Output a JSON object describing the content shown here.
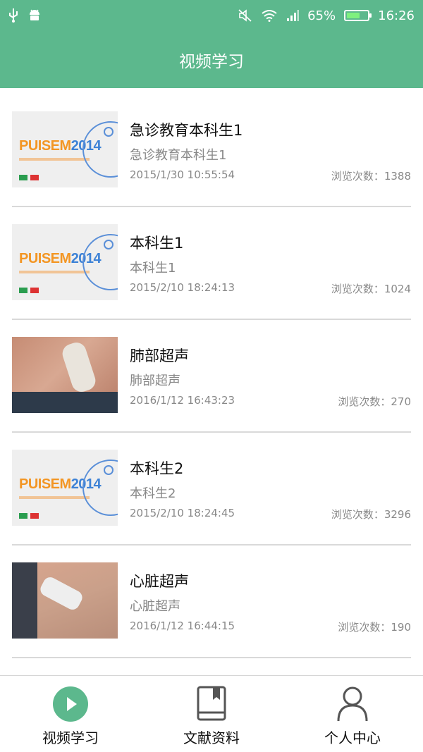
{
  "status_bar": {
    "battery": "65%",
    "time": "16:26",
    "icons": [
      "usb-icon",
      "android-icon",
      "mute-icon",
      "wifi-icon",
      "signal-icon",
      "battery-icon"
    ],
    "battery_level": 0.65
  },
  "header": {
    "title": "视频学习"
  },
  "videos": [
    {
      "title": "急诊教育本科生1",
      "subtitle": "急诊教育本科生1",
      "time": "2015/1/30 10:55:54",
      "views": "浏览次数：1388",
      "thumb": "banner"
    },
    {
      "title": "本科生1",
      "subtitle": "本科生1",
      "time": "2015/2/10 18:24:13",
      "views": "浏览次数：1024",
      "thumb": "banner"
    },
    {
      "title": "肺部超声",
      "subtitle": "肺部超声",
      "time": "2016/1/12 16:43:23",
      "views": "浏览次数：270",
      "thumb": "photo"
    },
    {
      "title": "本科生2",
      "subtitle": "本科生2",
      "time": "2015/2/10 18:24:45",
      "views": "浏览次数：3296",
      "thumb": "banner"
    },
    {
      "title": "心脏超声",
      "subtitle": "心脏超声",
      "time": "2016/1/12 16:44:15",
      "views": "浏览次数：190",
      "thumb": "photo"
    }
  ],
  "thumb_banner": {
    "brand": "PUISEM",
    "year": "2014"
  },
  "tabs": [
    {
      "label": "视频学习",
      "icon": "play-icon",
      "active": true
    },
    {
      "label": "文献资料",
      "icon": "book-icon",
      "active": false
    },
    {
      "label": "个人中心",
      "icon": "person-icon",
      "active": false
    }
  ],
  "colors": {
    "accent": "#5cb88d",
    "text_primary": "#111111",
    "text_secondary": "#888888",
    "divider": "#d9d9d9"
  }
}
